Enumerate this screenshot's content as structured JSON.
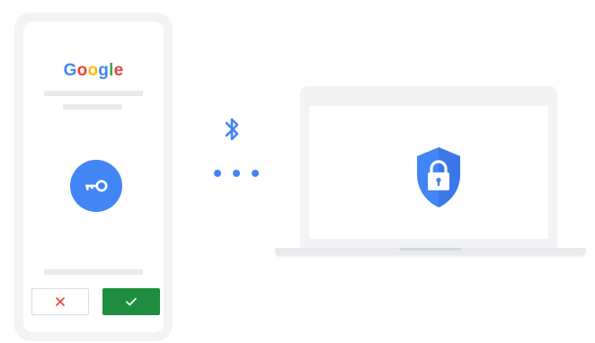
{
  "phone": {
    "brand": {
      "letters": [
        {
          "char": "G",
          "color": "#4285f4"
        },
        {
          "char": "o",
          "color": "#ea4335"
        },
        {
          "char": "o",
          "color": "#fbbc05"
        },
        {
          "char": "g",
          "color": "#4285f4"
        },
        {
          "char": "l",
          "color": "#34a853"
        },
        {
          "char": "e",
          "color": "#ea4335"
        }
      ]
    },
    "key_icon": "key-icon",
    "deny_icon": "close-icon",
    "approve_icon": "check-icon"
  },
  "connection": {
    "icon": "bluetooth-icon",
    "dots": 3
  },
  "laptop": {
    "icon": "shield-lock-icon"
  },
  "colors": {
    "blue": "#4285f4",
    "red": "#ea4335",
    "green": "#1e8e3e",
    "device_gray": "#f1f3f4",
    "placeholder_gray": "#e8eaed"
  }
}
